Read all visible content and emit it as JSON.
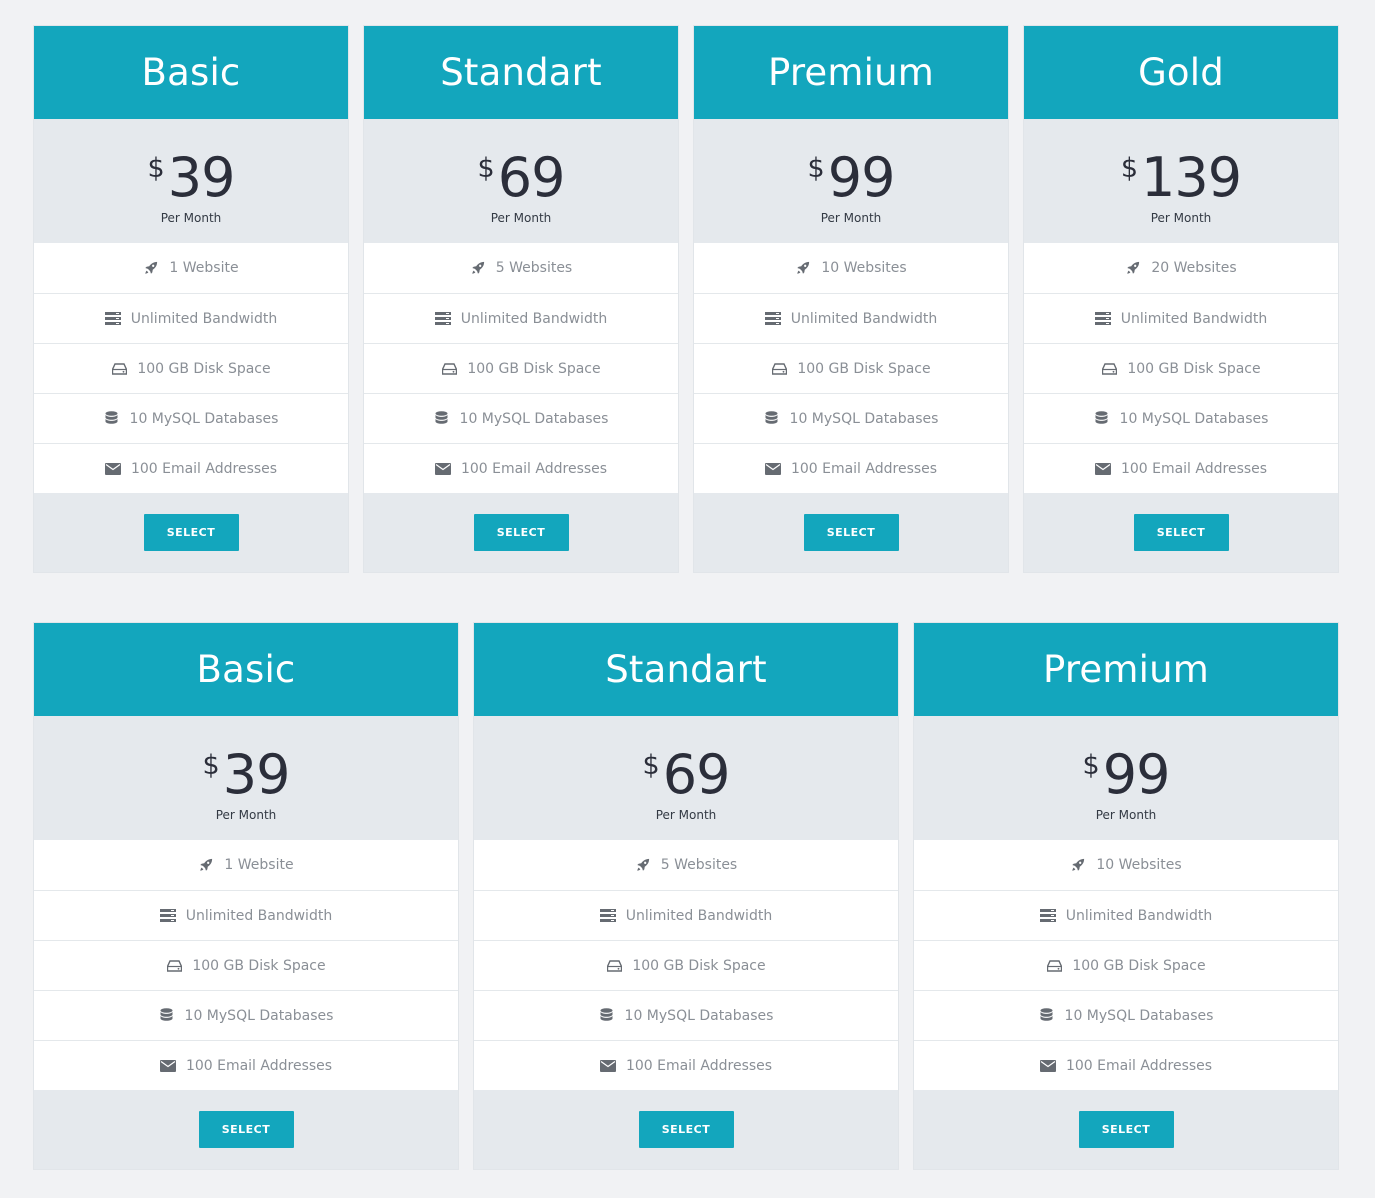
{
  "colors": {
    "accent": "#13a6bd",
    "price_bg": "#e5e9ed",
    "page_bg": "#f1f2f4",
    "feature_text": "#8a8f96",
    "price_text": "#2b2e3a"
  },
  "row1": {
    "cards": [
      {
        "name": "Basic",
        "currency": "$",
        "price": "39",
        "period": "Per Month",
        "features": [
          {
            "icon": "rocket-icon",
            "text": "1 Website"
          },
          {
            "icon": "server-icon",
            "text": "Unlimited Bandwidth"
          },
          {
            "icon": "hdd-icon",
            "text": "100 GB Disk Space"
          },
          {
            "icon": "database-icon",
            "text": "10 MySQL Databases"
          },
          {
            "icon": "envelope-icon",
            "text": "100 Email Addresses"
          }
        ],
        "button": "SELECT"
      },
      {
        "name": "Standart",
        "currency": "$",
        "price": "69",
        "period": "Per Month",
        "features": [
          {
            "icon": "rocket-icon",
            "text": "5 Websites"
          },
          {
            "icon": "server-icon",
            "text": "Unlimited Bandwidth"
          },
          {
            "icon": "hdd-icon",
            "text": "100 GB Disk Space"
          },
          {
            "icon": "database-icon",
            "text": "10 MySQL Databases"
          },
          {
            "icon": "envelope-icon",
            "text": "100 Email Addresses"
          }
        ],
        "button": "SELECT"
      },
      {
        "name": "Premium",
        "currency": "$",
        "price": "99",
        "period": "Per Month",
        "features": [
          {
            "icon": "rocket-icon",
            "text": "10 Websites"
          },
          {
            "icon": "server-icon",
            "text": "Unlimited Bandwidth"
          },
          {
            "icon": "hdd-icon",
            "text": "100 GB Disk Space"
          },
          {
            "icon": "database-icon",
            "text": "10 MySQL Databases"
          },
          {
            "icon": "envelope-icon",
            "text": "100 Email Addresses"
          }
        ],
        "button": "SELECT"
      },
      {
        "name": "Gold",
        "currency": "$",
        "price": "139",
        "period": "Per Month",
        "features": [
          {
            "icon": "rocket-icon",
            "text": "20 Websites"
          },
          {
            "icon": "server-icon",
            "text": "Unlimited Bandwidth"
          },
          {
            "icon": "hdd-icon",
            "text": "100 GB Disk Space"
          },
          {
            "icon": "database-icon",
            "text": "10 MySQL Databases"
          },
          {
            "icon": "envelope-icon",
            "text": "100 Email Addresses"
          }
        ],
        "button": "SELECT"
      }
    ]
  },
  "row2": {
    "cards": [
      {
        "name": "Basic",
        "currency": "$",
        "price": "39",
        "period": "Per Month",
        "features": [
          {
            "icon": "rocket-icon",
            "text": "1 Website"
          },
          {
            "icon": "server-icon",
            "text": "Unlimited Bandwidth"
          },
          {
            "icon": "hdd-icon",
            "text": "100 GB Disk Space"
          },
          {
            "icon": "database-icon",
            "text": "10 MySQL Databases"
          },
          {
            "icon": "envelope-icon",
            "text": "100 Email Addresses"
          }
        ],
        "button": "SELECT"
      },
      {
        "name": "Standart",
        "currency": "$",
        "price": "69",
        "period": "Per Month",
        "features": [
          {
            "icon": "rocket-icon",
            "text": "5 Websites"
          },
          {
            "icon": "server-icon",
            "text": "Unlimited Bandwidth"
          },
          {
            "icon": "hdd-icon",
            "text": "100 GB Disk Space"
          },
          {
            "icon": "database-icon",
            "text": "10 MySQL Databases"
          },
          {
            "icon": "envelope-icon",
            "text": "100 Email Addresses"
          }
        ],
        "button": "SELECT"
      },
      {
        "name": "Premium",
        "currency": "$",
        "price": "99",
        "period": "Per Month",
        "features": [
          {
            "icon": "rocket-icon",
            "text": "10 Websites"
          },
          {
            "icon": "server-icon",
            "text": "Unlimited Bandwidth"
          },
          {
            "icon": "hdd-icon",
            "text": "100 GB Disk Space"
          },
          {
            "icon": "database-icon",
            "text": "10 MySQL Databases"
          },
          {
            "icon": "envelope-icon",
            "text": "100 Email Addresses"
          }
        ],
        "button": "SELECT"
      }
    ]
  }
}
